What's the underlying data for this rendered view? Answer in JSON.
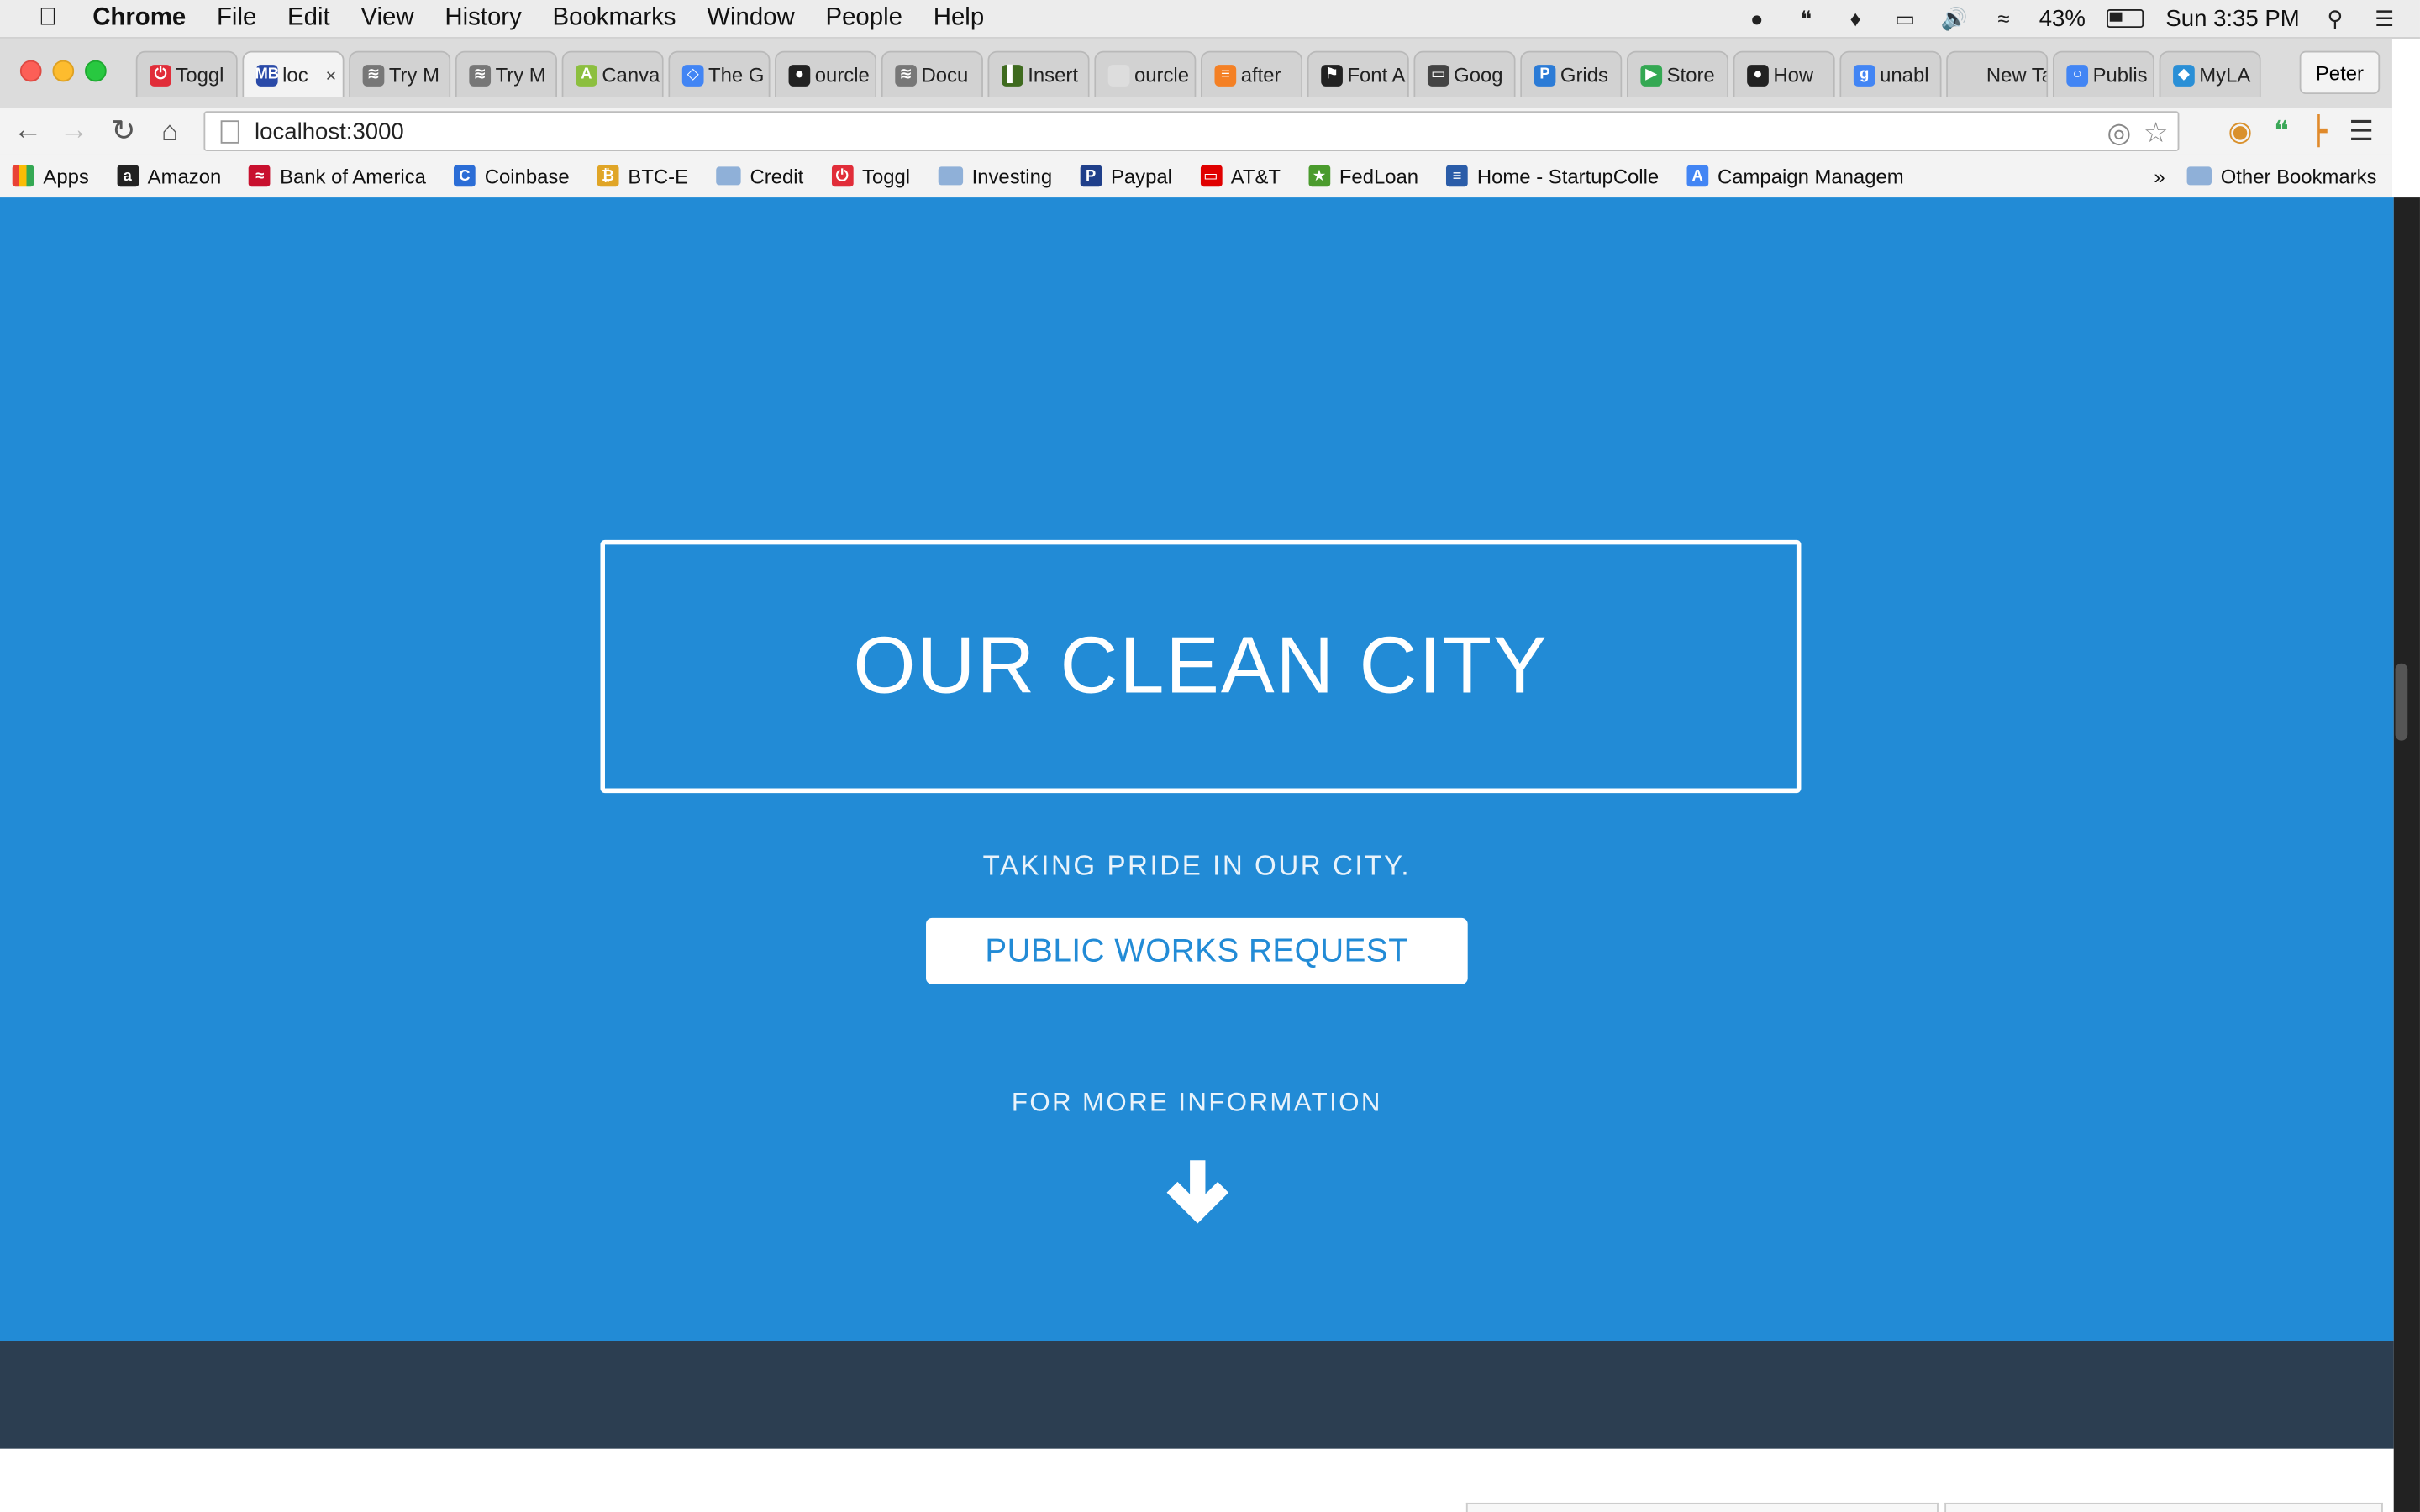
{
  "menubar": {
    "app_name": "Chrome",
    "menus": [
      "File",
      "Edit",
      "View",
      "History",
      "Bookmarks",
      "Window",
      "People",
      "Help"
    ],
    "battery": "43%",
    "clock": "Sun 3:35 PM"
  },
  "tabs": [
    {
      "label": "Toggl",
      "icon_color": "#e12d39",
      "icon_glyph": "⏻"
    },
    {
      "label": "loc",
      "icon_color": "#2a4aa8",
      "icon_glyph": "MB",
      "active": true
    },
    {
      "label": "Try M",
      "icon_color": "#777777",
      "icon_glyph": "≋"
    },
    {
      "label": "Try M",
      "icon_color": "#777777",
      "icon_glyph": "≋"
    },
    {
      "label": "Canva",
      "icon_color": "#8cbf3f",
      "icon_glyph": "A"
    },
    {
      "label": "The G",
      "icon_color": "#4285f4",
      "icon_glyph": "◇"
    },
    {
      "label": "ourcle",
      "icon_color": "#222222",
      "icon_glyph": "●"
    },
    {
      "label": "Docu",
      "icon_color": "#777777",
      "icon_glyph": "≋"
    },
    {
      "label": "Insert",
      "icon_color": "#3f6b1f",
      "icon_glyph": "▌"
    },
    {
      "label": "ourcle",
      "icon_color": "#dddddd",
      "icon_glyph": ""
    },
    {
      "label": "after",
      "icon_color": "#f48024",
      "icon_glyph": "≡"
    },
    {
      "label": "Font A",
      "icon_color": "#222222",
      "icon_glyph": "⚑"
    },
    {
      "label": "Goog",
      "icon_color": "#444444",
      "icon_glyph": "▭"
    },
    {
      "label": "Grids",
      "icon_color": "#2b7bd6",
      "icon_glyph": "P"
    },
    {
      "label": "Store",
      "icon_color": "#34a853",
      "icon_glyph": "▶"
    },
    {
      "label": "How",
      "icon_color": "#222222",
      "icon_glyph": "●"
    },
    {
      "label": "unabl",
      "icon_color": "#4285f4",
      "icon_glyph": "g"
    },
    {
      "label": "New Tab",
      "icon_color": "#d2d2d2",
      "icon_glyph": ""
    },
    {
      "label": "Publis",
      "icon_color": "#4285f4",
      "icon_glyph": "○"
    },
    {
      "label": "MyLA",
      "icon_color": "#2a8fd6",
      "icon_glyph": "◆"
    }
  ],
  "profile_name": "Peter",
  "address_bar": {
    "url": "localhost:3000"
  },
  "bookmarks": [
    {
      "label": "Apps",
      "kind": "apps"
    },
    {
      "label": "Amazon",
      "icon_color": "#222222",
      "icon_glyph": "a"
    },
    {
      "label": "Bank of America",
      "icon_color": "#c8102e",
      "icon_glyph": "≈"
    },
    {
      "label": "Coinbase",
      "icon_color": "#2b6dd6",
      "icon_glyph": "C"
    },
    {
      "label": "BTC-E",
      "icon_color": "#e0a526",
      "icon_glyph": "₿"
    },
    {
      "label": "Credit",
      "kind": "folder"
    },
    {
      "label": "Toggl",
      "icon_color": "#e12d39",
      "icon_glyph": "⏻"
    },
    {
      "label": "Investing",
      "kind": "folder"
    },
    {
      "label": "Paypal",
      "icon_color": "#1f3f8a",
      "icon_glyph": "P"
    },
    {
      "label": "AT&T",
      "icon_color": "#e00000",
      "icon_glyph": "▭"
    },
    {
      "label": "FedLoan",
      "icon_color": "#4a9b2d",
      "icon_glyph": "★"
    },
    {
      "label": "Home - StartupColle",
      "icon_color": "#2a5ca8",
      "icon_glyph": "≡"
    },
    {
      "label": "Campaign Managem",
      "icon_color": "#4285f4",
      "icon_glyph": "A"
    }
  ],
  "other_bookmarks": "Other Bookmarks",
  "hero": {
    "title": "OUR CLEAN CITY",
    "tagline": "TAKING PRIDE IN OUR CITY.",
    "cta_label": "PUBLIC WORKS REQUEST",
    "more_info": "FOR MORE INFORMATION"
  },
  "colors": {
    "hero_bg": "#228bd6",
    "footer_bg": "#2c3e51"
  }
}
